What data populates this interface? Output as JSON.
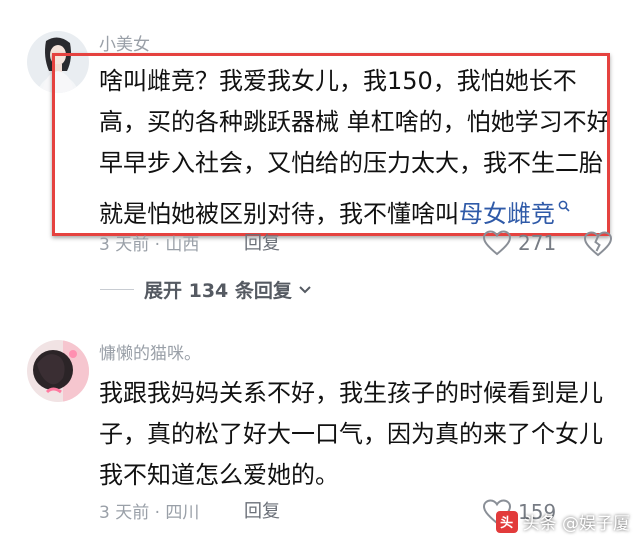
{
  "comments": [
    {
      "username": "小美女",
      "lines": [
        "啥叫雌竞？我爱我女儿，我150，我怕她长不",
        "高，买的各种跳跃器械 单杠啥的，怕她学习不好",
        "早早步入社会，又怕给的压力太大，我不生二胎"
      ],
      "last_line_text": "就是怕她被区别对待，我不懂啥叫",
      "last_line_link": "母女雌竞",
      "meta": "3 天前 · 山西",
      "reply_label": "回复",
      "like_count": "271",
      "replies_label": "展开 134 条回复"
    },
    {
      "username": "慵懒的猫咪。",
      "lines": [
        "我跟我妈妈关系不好，我生孩子的时候看到是儿",
        "子，真的松了好大一口气，因为真的来了个女儿",
        "我不知道怎么爱她的。"
      ],
      "meta": "3 天前 · 四川",
      "reply_label": "回复",
      "like_count": "159"
    }
  ],
  "watermark": {
    "logo_text": "头",
    "text": "头条 @娱子厦"
  },
  "colors": {
    "highlight": "#e5423f",
    "link": "#2f5aa8",
    "meta": "#9aa0a8"
  }
}
